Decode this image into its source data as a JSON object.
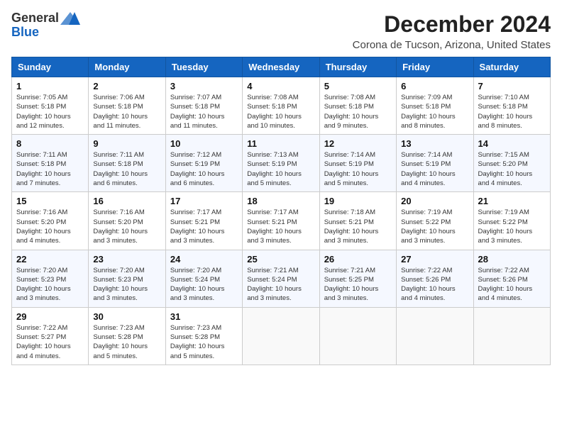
{
  "logo": {
    "general": "General",
    "blue": "Blue"
  },
  "header": {
    "month": "December 2024",
    "location": "Corona de Tucson, Arizona, United States"
  },
  "weekdays": [
    "Sunday",
    "Monday",
    "Tuesday",
    "Wednesday",
    "Thursday",
    "Friday",
    "Saturday"
  ],
  "weeks": [
    [
      {
        "day": 1,
        "info": "Sunrise: 7:05 AM\nSunset: 5:18 PM\nDaylight: 10 hours\nand 12 minutes."
      },
      {
        "day": 2,
        "info": "Sunrise: 7:06 AM\nSunset: 5:18 PM\nDaylight: 10 hours\nand 11 minutes."
      },
      {
        "day": 3,
        "info": "Sunrise: 7:07 AM\nSunset: 5:18 PM\nDaylight: 10 hours\nand 11 minutes."
      },
      {
        "day": 4,
        "info": "Sunrise: 7:08 AM\nSunset: 5:18 PM\nDaylight: 10 hours\nand 10 minutes."
      },
      {
        "day": 5,
        "info": "Sunrise: 7:08 AM\nSunset: 5:18 PM\nDaylight: 10 hours\nand 9 minutes."
      },
      {
        "day": 6,
        "info": "Sunrise: 7:09 AM\nSunset: 5:18 PM\nDaylight: 10 hours\nand 8 minutes."
      },
      {
        "day": 7,
        "info": "Sunrise: 7:10 AM\nSunset: 5:18 PM\nDaylight: 10 hours\nand 8 minutes."
      }
    ],
    [
      {
        "day": 8,
        "info": "Sunrise: 7:11 AM\nSunset: 5:18 PM\nDaylight: 10 hours\nand 7 minutes."
      },
      {
        "day": 9,
        "info": "Sunrise: 7:11 AM\nSunset: 5:18 PM\nDaylight: 10 hours\nand 6 minutes."
      },
      {
        "day": 10,
        "info": "Sunrise: 7:12 AM\nSunset: 5:19 PM\nDaylight: 10 hours\nand 6 minutes."
      },
      {
        "day": 11,
        "info": "Sunrise: 7:13 AM\nSunset: 5:19 PM\nDaylight: 10 hours\nand 5 minutes."
      },
      {
        "day": 12,
        "info": "Sunrise: 7:14 AM\nSunset: 5:19 PM\nDaylight: 10 hours\nand 5 minutes."
      },
      {
        "day": 13,
        "info": "Sunrise: 7:14 AM\nSunset: 5:19 PM\nDaylight: 10 hours\nand 4 minutes."
      },
      {
        "day": 14,
        "info": "Sunrise: 7:15 AM\nSunset: 5:20 PM\nDaylight: 10 hours\nand 4 minutes."
      }
    ],
    [
      {
        "day": 15,
        "info": "Sunrise: 7:16 AM\nSunset: 5:20 PM\nDaylight: 10 hours\nand 4 minutes."
      },
      {
        "day": 16,
        "info": "Sunrise: 7:16 AM\nSunset: 5:20 PM\nDaylight: 10 hours\nand 3 minutes."
      },
      {
        "day": 17,
        "info": "Sunrise: 7:17 AM\nSunset: 5:21 PM\nDaylight: 10 hours\nand 3 minutes."
      },
      {
        "day": 18,
        "info": "Sunrise: 7:17 AM\nSunset: 5:21 PM\nDaylight: 10 hours\nand 3 minutes."
      },
      {
        "day": 19,
        "info": "Sunrise: 7:18 AM\nSunset: 5:21 PM\nDaylight: 10 hours\nand 3 minutes."
      },
      {
        "day": 20,
        "info": "Sunrise: 7:19 AM\nSunset: 5:22 PM\nDaylight: 10 hours\nand 3 minutes."
      },
      {
        "day": 21,
        "info": "Sunrise: 7:19 AM\nSunset: 5:22 PM\nDaylight: 10 hours\nand 3 minutes."
      }
    ],
    [
      {
        "day": 22,
        "info": "Sunrise: 7:20 AM\nSunset: 5:23 PM\nDaylight: 10 hours\nand 3 minutes."
      },
      {
        "day": 23,
        "info": "Sunrise: 7:20 AM\nSunset: 5:23 PM\nDaylight: 10 hours\nand 3 minutes."
      },
      {
        "day": 24,
        "info": "Sunrise: 7:20 AM\nSunset: 5:24 PM\nDaylight: 10 hours\nand 3 minutes."
      },
      {
        "day": 25,
        "info": "Sunrise: 7:21 AM\nSunset: 5:24 PM\nDaylight: 10 hours\nand 3 minutes."
      },
      {
        "day": 26,
        "info": "Sunrise: 7:21 AM\nSunset: 5:25 PM\nDaylight: 10 hours\nand 3 minutes."
      },
      {
        "day": 27,
        "info": "Sunrise: 7:22 AM\nSunset: 5:26 PM\nDaylight: 10 hours\nand 4 minutes."
      },
      {
        "day": 28,
        "info": "Sunrise: 7:22 AM\nSunset: 5:26 PM\nDaylight: 10 hours\nand 4 minutes."
      }
    ],
    [
      {
        "day": 29,
        "info": "Sunrise: 7:22 AM\nSunset: 5:27 PM\nDaylight: 10 hours\nand 4 minutes."
      },
      {
        "day": 30,
        "info": "Sunrise: 7:23 AM\nSunset: 5:28 PM\nDaylight: 10 hours\nand 5 minutes."
      },
      {
        "day": 31,
        "info": "Sunrise: 7:23 AM\nSunset: 5:28 PM\nDaylight: 10 hours\nand 5 minutes."
      },
      null,
      null,
      null,
      null
    ]
  ]
}
